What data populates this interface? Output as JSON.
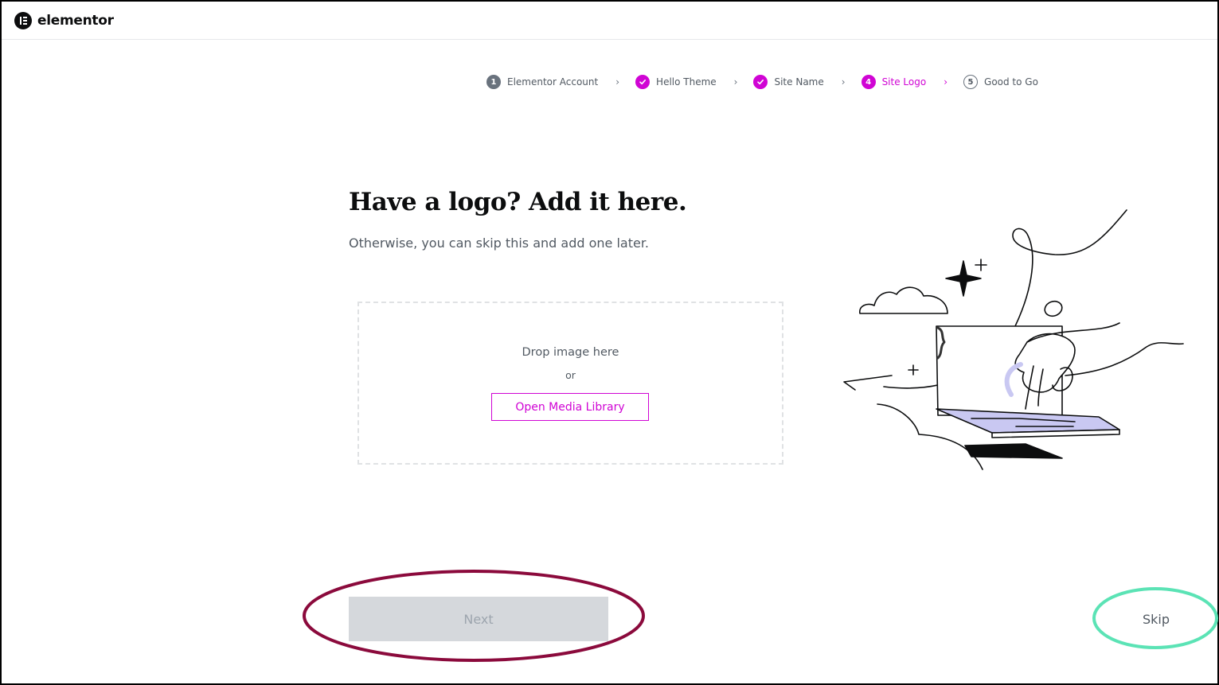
{
  "app": {
    "brand": "elementor"
  },
  "steps": [
    {
      "number": "1",
      "label": "Elementor Account",
      "state": "pending"
    },
    {
      "number": "2",
      "label": "Hello Theme",
      "state": "done"
    },
    {
      "number": "3",
      "label": "Site Name",
      "state": "done"
    },
    {
      "number": "4",
      "label": "Site Logo",
      "state": "active"
    },
    {
      "number": "5",
      "label": "Good to Go",
      "state": "upcoming"
    }
  ],
  "step_separator": "›",
  "content": {
    "title": "Have a logo? Add it here.",
    "subtitle": "Otherwise, you can skip this and add one later."
  },
  "dropzone": {
    "drop_text": "Drop image here",
    "or_text": "or",
    "media_button": "Open Media Library"
  },
  "footer": {
    "next_label": "Next",
    "skip_label": "Skip"
  },
  "colors": {
    "accent": "#d004d4",
    "next_disabled_bg": "#d5d8dc",
    "annotation_next": "#8b0a3c",
    "annotation_skip": "#5be3b5"
  },
  "icons": [
    "elementor-logo-icon",
    "check-icon",
    "chevron-right-icon"
  ]
}
